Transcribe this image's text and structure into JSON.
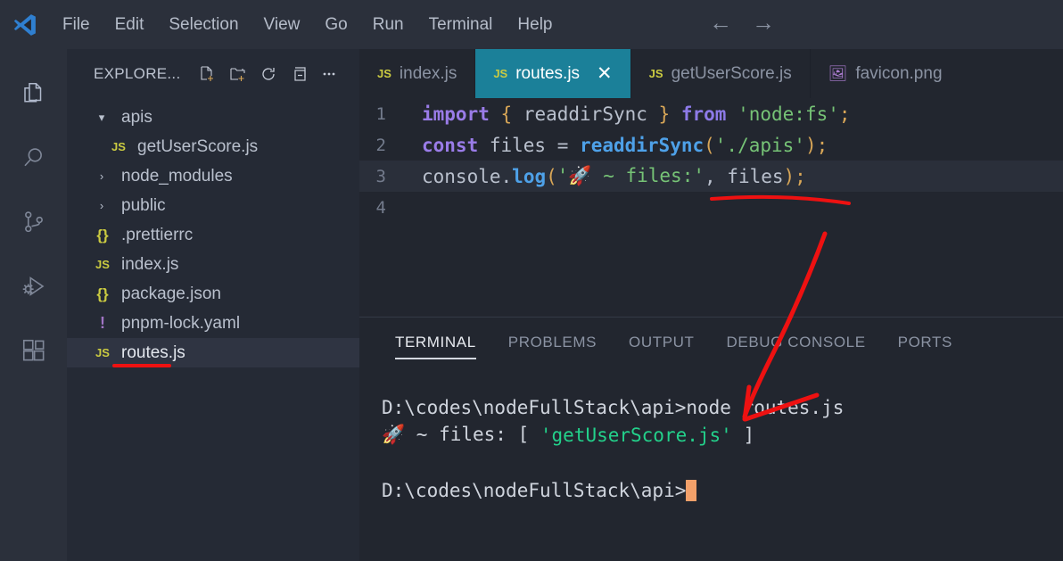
{
  "window": {
    "logo": "vscode-logo",
    "menu": [
      "File",
      "Edit",
      "Selection",
      "View",
      "Go",
      "Run",
      "Terminal",
      "Help"
    ],
    "nav_back": "←",
    "nav_forward": "→"
  },
  "activitybar": {
    "items": [
      {
        "name": "explorer",
        "icon": "files-icon",
        "active": true
      },
      {
        "name": "search",
        "icon": "search-icon",
        "active": false
      },
      {
        "name": "source-control",
        "icon": "source-control-icon",
        "active": false
      },
      {
        "name": "run-debug",
        "icon": "run-debug-icon",
        "active": false
      },
      {
        "name": "extensions",
        "icon": "extensions-icon",
        "active": false
      }
    ]
  },
  "sidebar": {
    "title": "EXPLORE...",
    "tools": [
      {
        "name": "new-file",
        "icon": "new-file-icon"
      },
      {
        "name": "new-folder",
        "icon": "new-folder-icon"
      },
      {
        "name": "refresh",
        "icon": "refresh-icon"
      },
      {
        "name": "collapse-all",
        "icon": "collapse-all-icon"
      },
      {
        "name": "more-actions",
        "icon": "ellipsis-icon"
      }
    ],
    "tree": [
      {
        "label": "apis",
        "kind": "folder",
        "expanded": true,
        "indent": 0,
        "icon": "chevron-down-icon",
        "selected": false
      },
      {
        "label": "getUserScore.js",
        "kind": "js",
        "indent": 1,
        "icon": "js-icon",
        "selected": false
      },
      {
        "label": "node_modules",
        "kind": "folder",
        "expanded": false,
        "indent": 0,
        "icon": "chevron-right-icon",
        "selected": false
      },
      {
        "label": "public",
        "kind": "folder",
        "expanded": false,
        "indent": 0,
        "icon": "chevron-right-icon",
        "selected": false
      },
      {
        "label": ".prettierrc",
        "kind": "json",
        "indent": 0,
        "icon": "json-icon",
        "selected": false
      },
      {
        "label": "index.js",
        "kind": "js",
        "indent": 0,
        "icon": "js-icon",
        "selected": false
      },
      {
        "label": "package.json",
        "kind": "json",
        "indent": 0,
        "icon": "json-icon",
        "selected": false
      },
      {
        "label": "pnpm-lock.yaml",
        "kind": "yaml",
        "indent": 0,
        "icon": "yaml-icon",
        "selected": false
      },
      {
        "label": "routes.js",
        "kind": "js",
        "indent": 0,
        "icon": "js-icon",
        "selected": true
      }
    ]
  },
  "editor": {
    "tabs": [
      {
        "label": "index.js",
        "icon": "js-icon",
        "active": false,
        "closable": false
      },
      {
        "label": "routes.js",
        "icon": "js-icon",
        "active": true,
        "closable": true,
        "close_glyph": "✕"
      },
      {
        "label": "getUserScore.js",
        "icon": "js-icon",
        "active": false,
        "closable": false
      },
      {
        "label": "favicon.png",
        "icon": "image-icon",
        "active": false,
        "closable": false
      }
    ],
    "active_line": 3,
    "lines": [
      {
        "number": "1",
        "tokens": [
          {
            "t": "import",
            "c": "kw"
          },
          {
            "t": " ",
            "c": "plain"
          },
          {
            "t": "{",
            "c": "brace"
          },
          {
            "t": " readdirSync ",
            "c": "plain"
          },
          {
            "t": "}",
            "c": "brace"
          },
          {
            "t": " ",
            "c": "plain"
          },
          {
            "t": "from",
            "c": "kw2"
          },
          {
            "t": " ",
            "c": "plain"
          },
          {
            "t": "'node:fs'",
            "c": "str"
          },
          {
            "t": ";",
            "c": "semi"
          }
        ]
      },
      {
        "number": "2",
        "tokens": [
          {
            "t": "const",
            "c": "kw"
          },
          {
            "t": " files ",
            "c": "plain"
          },
          {
            "t": "=",
            "c": "op"
          },
          {
            "t": " ",
            "c": "plain"
          },
          {
            "t": "readdirSync",
            "c": "fn"
          },
          {
            "t": "(",
            "c": "brace"
          },
          {
            "t": "'./apis'",
            "c": "str"
          },
          {
            "t": ")",
            "c": "brace"
          },
          {
            "t": ";",
            "c": "semi"
          }
        ]
      },
      {
        "number": "3",
        "tokens": [
          {
            "t": "console",
            "c": "plain"
          },
          {
            "t": ".",
            "c": "punct"
          },
          {
            "t": "log",
            "c": "fn"
          },
          {
            "t": "(",
            "c": "brace"
          },
          {
            "t": "'🚀 ~ files:'",
            "c": "str"
          },
          {
            "t": ",",
            "c": "punct"
          },
          {
            "t": " files",
            "c": "plain"
          },
          {
            "t": ")",
            "c": "brace"
          },
          {
            "t": ";",
            "c": "semi"
          }
        ]
      },
      {
        "number": "4",
        "tokens": []
      }
    ]
  },
  "panel": {
    "tabs": [
      "TERMINAL",
      "PROBLEMS",
      "OUTPUT",
      "DEBUG CONSOLE",
      "PORTS"
    ],
    "active_tab": "TERMINAL",
    "terminal": {
      "lines": [
        {
          "segments": [
            {
              "t": "D:\\codes\\nodeFullStack\\api>node routes.js",
              "c": "plain"
            }
          ]
        },
        {
          "segments": [
            {
              "t": "🚀 ~ files: [ ",
              "c": "plain"
            },
            {
              "t": "'getUserScore.js'",
              "c": "green"
            },
            {
              "t": " ]",
              "c": "plain"
            }
          ]
        },
        {
          "segments": []
        },
        {
          "segments": [
            {
              "t": "D:\\codes\\nodeFullStack\\api>",
              "c": "plain"
            },
            {
              "t": "",
              "c": "cursor"
            }
          ]
        }
      ]
    }
  },
  "annotations": {
    "color": "#ee1111",
    "marks": [
      "underline-files-arg",
      "arrow-to-terminal-command",
      "underline-routes-js-sidebar"
    ]
  },
  "colors": {
    "titlebar_bg": "#2b303b",
    "sidebar_bg": "#252a35",
    "editor_bg": "#22262f",
    "active_tab_bg": "#1b8099",
    "selection_bg": "#2f3442",
    "terminal_green": "#23d18b",
    "cursor": "#f2a06a",
    "annotation_red": "#ee1111"
  }
}
